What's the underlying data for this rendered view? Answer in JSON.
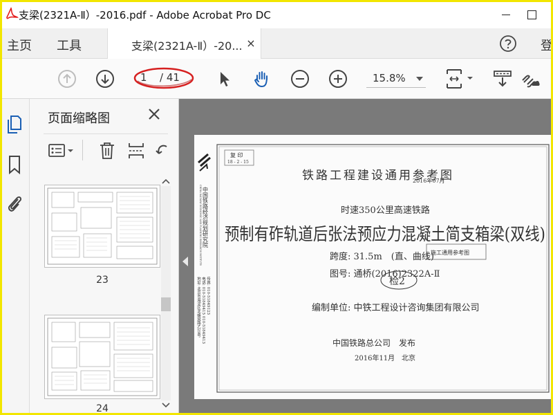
{
  "window": {
    "title": "支梁(2321A-Ⅱ）-2016.pdf - Adobe Acrobat Pro DC",
    "sign_in": "登"
  },
  "tabs": {
    "home": "主页",
    "tools": "工具",
    "document": "支梁(2321A-Ⅱ）-20...",
    "close": "×"
  },
  "toolbar": {
    "current_page": "1",
    "total_pages": "/ 41",
    "zoom": "15.8%"
  },
  "panel": {
    "title": "页面缩略图",
    "thumbnails": [
      {
        "label": "23"
      },
      {
        "label": "24"
      }
    ]
  },
  "document": {
    "stamp_lines": [
      "复 印",
      "18 - 2 - 15"
    ],
    "main_title": "铁路工程建设通用参考图",
    "stamp_overlay": "2016年07月",
    "subtitle": "时速350公里高速铁路",
    "big_title": "预制有砟轨道后张法预应力混凝土简支箱梁(双线)",
    "span": "跨度: 31.5m　(直、曲线)",
    "drawing_no": "图号: 通桥(2016)2322A-Ⅱ",
    "oval_stamp": "检2",
    "box_stamp": "施工通用参考图",
    "compiler": "编制单位: 中铁工程设计咨询集团有限公司",
    "publisher": "中国铁路总公司　发布",
    "pub_date": "2016年11月",
    "pub_place": "北京",
    "side_org": "中国铁路经济规划研究院",
    "side_org_en": "CHINA RAILWAY ECONOMIC AND PLANNING RESEARCH INSTITUTE",
    "side_address": "地址: 北京市海淀区北蜂窝路乙29号",
    "side_phone": "电话: 010-51849415  010-51849413",
    "side_fax": "传真: 010-51849123"
  },
  "colors": {
    "highlight_border": "#f2e600",
    "annotation_red": "#d62020",
    "hand_tool_blue": "#1a5fb4",
    "acrobat_red": "#e31b1b"
  },
  "icons": {
    "rail": [
      "pages-icon",
      "bookmark-icon",
      "attachment-icon"
    ],
    "toolbar": [
      "prev-page-icon",
      "next-page-icon",
      "select-cursor-icon",
      "hand-tool-icon",
      "zoom-out-icon",
      "zoom-in-icon",
      "fit-page-icon",
      "comment-icon",
      "share-link-icon"
    ]
  }
}
